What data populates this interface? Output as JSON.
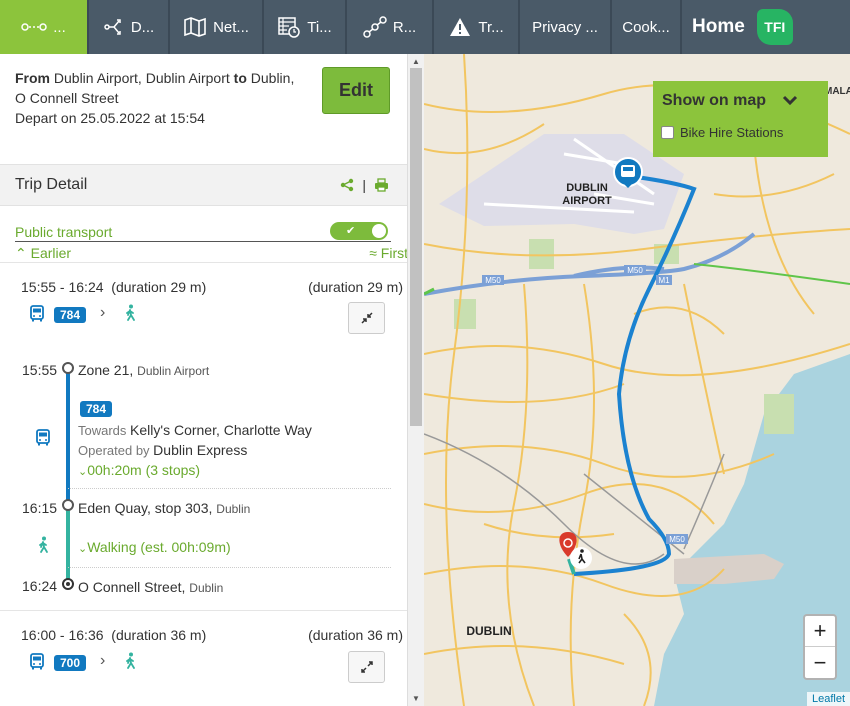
{
  "nav": {
    "tabs": [
      {
        "icon": "route-icon",
        "label": "..."
      },
      {
        "icon": "directions-icon",
        "label": "D..."
      },
      {
        "icon": "map-icon",
        "label": "Net..."
      },
      {
        "icon": "timetable-icon",
        "label": "Ti..."
      },
      {
        "icon": "route-planner-icon",
        "label": "R..."
      },
      {
        "icon": "warning-icon",
        "label": "Tr..."
      },
      {
        "label": "Privacy ..."
      },
      {
        "label": "Cook..."
      }
    ],
    "home_label": "Home",
    "logo_text": "TFI"
  },
  "summary": {
    "from_label": "From",
    "from": "Dublin Airport, Dublin Airport",
    "to_label": "to",
    "to": "Dublin, O Connell Street",
    "depart": "Depart on 25.05.2022 at 15:54",
    "edit_label": "Edit"
  },
  "trip_detail": {
    "title": "Trip Detail",
    "separator": "|",
    "public_transport_label": "Public transport",
    "earlier_label": "Earlier",
    "first_label": "First"
  },
  "trips": [
    {
      "times": "15:55 - 16:24",
      "duration_left": "(duration 29 m)",
      "duration_right": "(duration 29 m)",
      "route": "784"
    },
    {
      "times": "16:00 - 16:36",
      "duration_left": "(duration 36 m)",
      "duration_right": "(duration 36 m)",
      "route": "700"
    }
  ],
  "detail": {
    "stop1_time": "15:55",
    "stop1_name": "Zone 21,",
    "stop1_area": "Dublin Airport",
    "route": "784",
    "towards_label": "Towards",
    "towards": "Kelly's Corner, Charlotte Way",
    "operated_label": "Operated by",
    "operator": "Dublin Express",
    "ride_info": "00h:20m (3 stops)",
    "stop2_time": "16:15",
    "stop2_name": "Eden Quay, stop 303,",
    "stop2_area": "Dublin",
    "walk_info": "Walking (est. 00h:09m)",
    "stop3_time": "16:24",
    "stop3_name": "O Connell Street,",
    "stop3_area": "Dublin"
  },
  "map": {
    "show_on_map": "Show on map",
    "bike_label": "Bike Hire Stations",
    "labels": {
      "airport_l1": "DUBLIN",
      "airport_l2": "AIRPORT",
      "city": "DUBLIN",
      "m50a": "M50",
      "m50b": "M50",
      "m1": "M1",
      "m50c": "M50",
      "mala": "MALA"
    },
    "zoom_in": "+",
    "zoom_out": "−",
    "attribution": "Leaflet"
  },
  "colors": {
    "accent": "#8cc43c",
    "nav": "#4a5a68",
    "bus": "#1179c0",
    "walk": "#34b3a0",
    "route_line": "#1b82d0",
    "pin": "#d93a2b"
  }
}
